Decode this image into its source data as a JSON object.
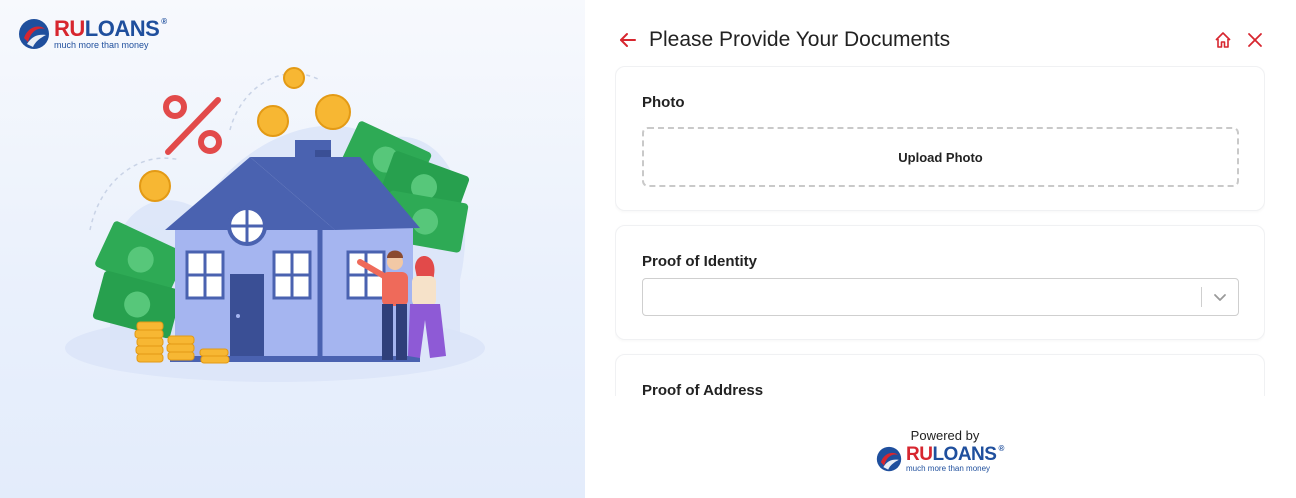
{
  "brand": {
    "name_part1": "RU",
    "name_part2": "LOANS",
    "registered": "®",
    "tagline": "much more than money"
  },
  "header": {
    "title": "Please Provide Your Documents",
    "back_icon": "arrow-left-icon",
    "home_icon": "home-icon",
    "close_icon": "close-icon"
  },
  "sections": {
    "photo": {
      "label": "Photo",
      "upload_label": "Upload Photo"
    },
    "identity": {
      "label": "Proof of Identity",
      "selected_value": ""
    },
    "address": {
      "label": "Proof of Address"
    }
  },
  "footer": {
    "powered_by": "Powered by"
  },
  "colors": {
    "accent_red": "#d7262f",
    "brand_blue": "#1f4f9d",
    "house_blue": "#4a62b0"
  }
}
